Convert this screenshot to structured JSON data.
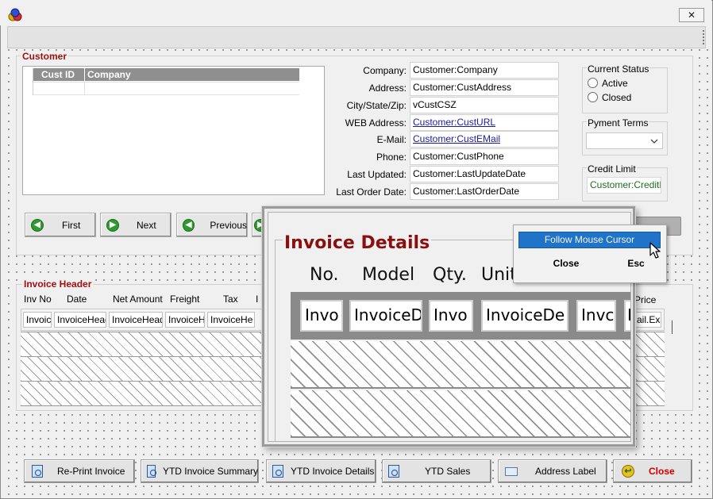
{
  "window": {
    "close_glyph": "✕"
  },
  "customer": {
    "title": "Customer",
    "grid_headers": [
      "Cust ID",
      "Company"
    ],
    "fields": [
      {
        "label": "Company:",
        "value": "Customer:Company",
        "link": false
      },
      {
        "label": "Address:",
        "value": "Customer:CustAddress",
        "link": false
      },
      {
        "label": "City/State/Zip:",
        "value": "vCustCSZ",
        "link": false
      },
      {
        "label": "WEB Address:",
        "value": "Customer:CustURL",
        "link": true
      },
      {
        "label": "E-Mail:",
        "value": "Customer:CustEMail",
        "link": true
      },
      {
        "label": "Phone:",
        "value": "Customer:CustPhone",
        "link": false
      },
      {
        "label": "Last Updated:",
        "value": "Customer:LastUpdateDate",
        "link": false
      },
      {
        "label": "Last Order Date:",
        "value": "Customer:LastOrderDate",
        "link": false
      }
    ],
    "status": {
      "title": "Current Status",
      "options": [
        "Active",
        "Closed"
      ]
    },
    "payment_terms": {
      "title": "Pyment Terms",
      "value": ""
    },
    "credit_limit": {
      "title": "Credit Limit",
      "value": "Customer:CreditLir"
    }
  },
  "nav": {
    "first": "First",
    "next": "Next",
    "previous": "Previous"
  },
  "invoice_header": {
    "title": "Invoice Header",
    "columns": [
      "Inv No",
      "Date",
      "Net Amount",
      "Freight",
      "Tax",
      "I"
    ],
    "cells": [
      "Invoic",
      "InvoiceHead",
      "InvoiceHead",
      "InvoiceH",
      "InvoiceHe"
    ],
    "right_col_label": "Price",
    "right_cell": "ail.Ex"
  },
  "zoom": {
    "title": "Invoice Details",
    "columns": [
      "No.",
      "Model",
      "Qty.",
      "Unit"
    ],
    "cells": [
      "Invo",
      "InvoiceD",
      "Invo",
      "InvoiceDe",
      "Invc",
      "I"
    ]
  },
  "context_menu": {
    "follow": "Follow Mouse Cursor",
    "close": "Close",
    "esc": "Esc"
  },
  "bottom_buttons": {
    "reprint": "Re-Print Invoice",
    "ytd_summary": "YTD Invoice Summary",
    "ytd_details": "YTD Invoice Details",
    "ytd_sales": "YTD Sales",
    "address_label": "Address Label",
    "close": "Close"
  },
  "colors": {
    "group_title": "#a01010",
    "selection": "#1f73c8",
    "link": "#1a1aa6",
    "close_text": "#cc0000"
  }
}
